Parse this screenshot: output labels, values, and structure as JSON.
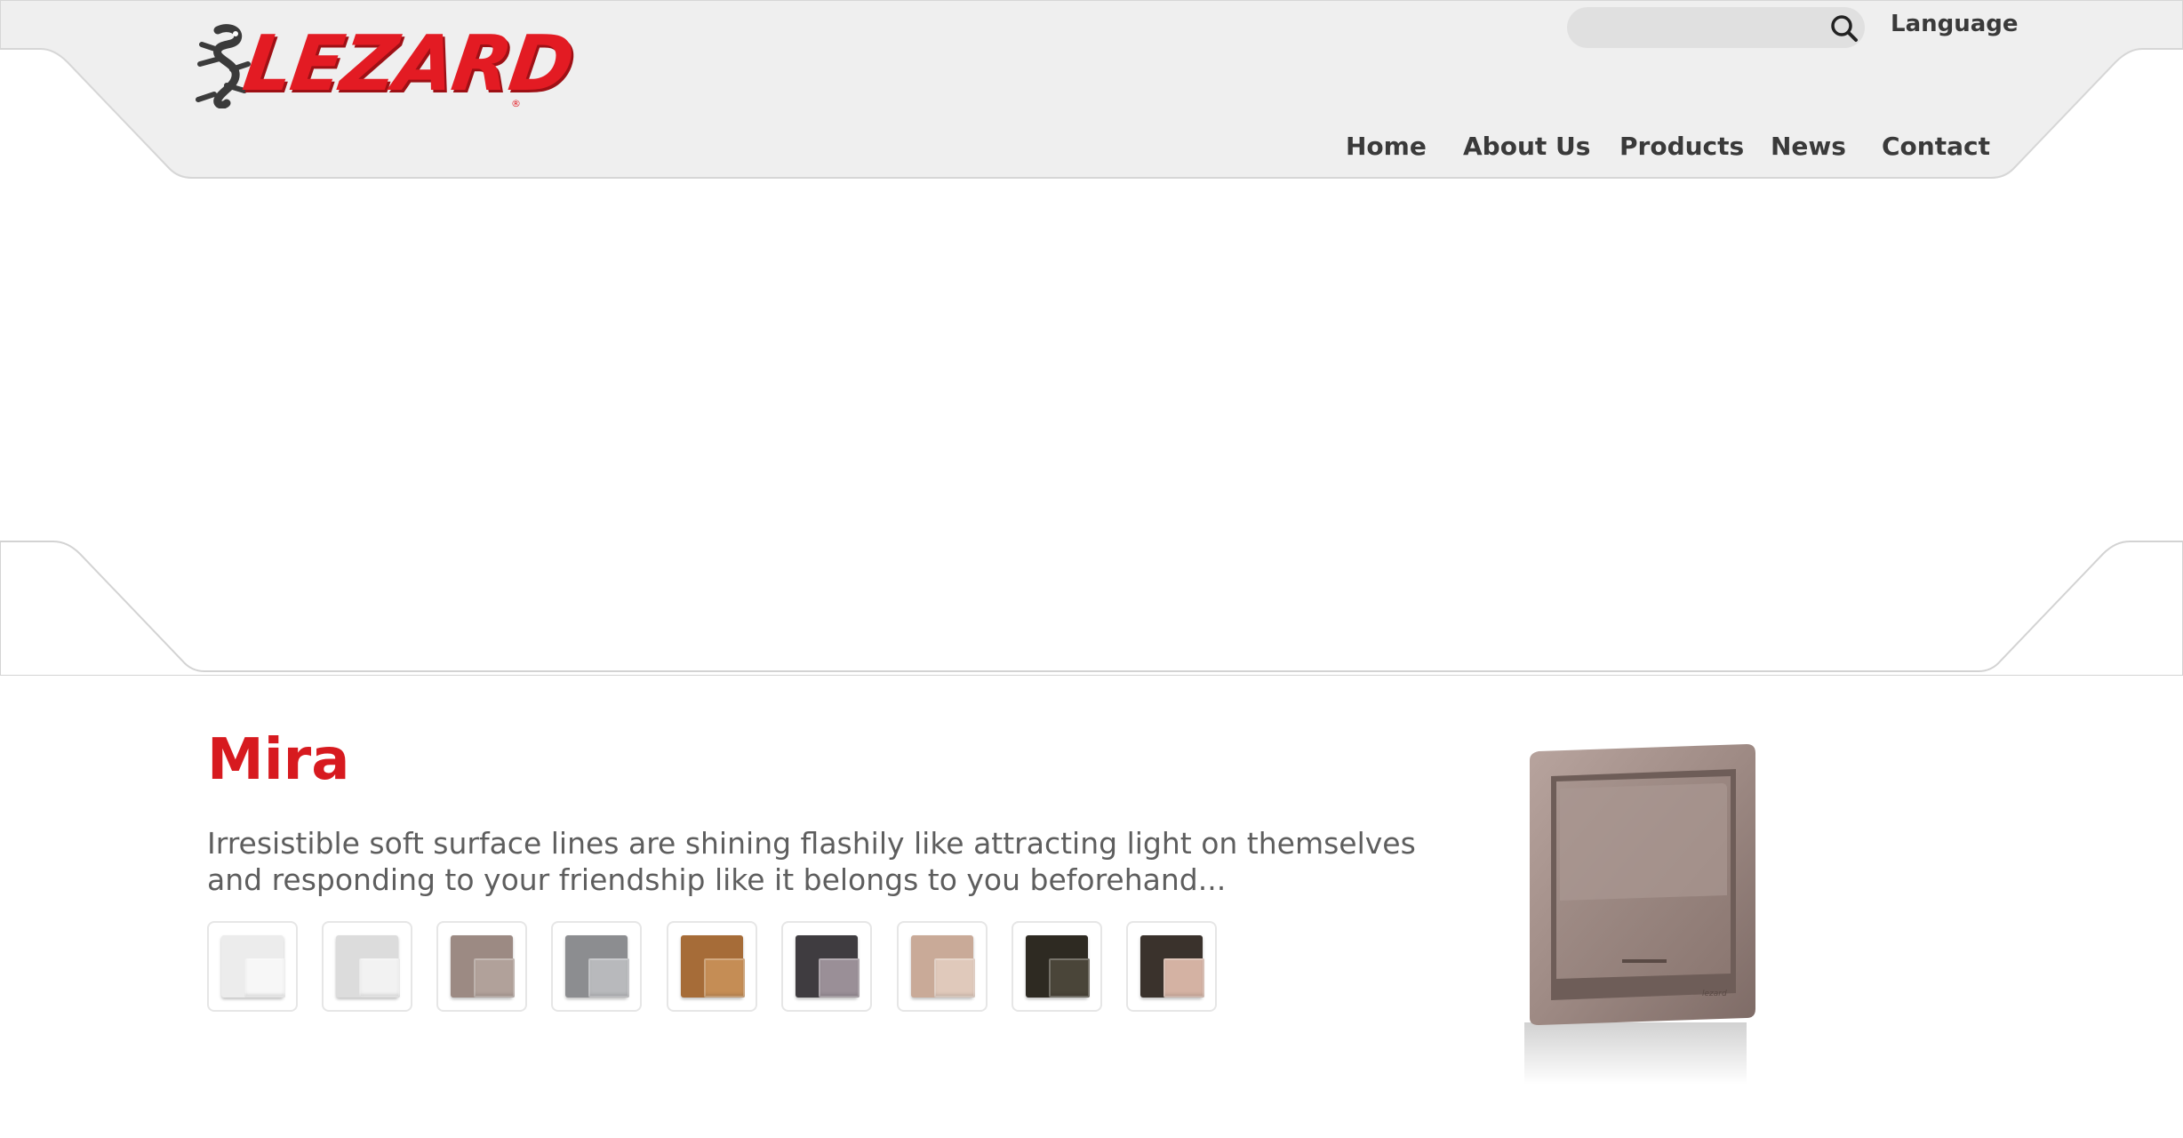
{
  "brand": {
    "name": "LEZARD",
    "mark": "®"
  },
  "search": {
    "placeholder": "",
    "value": ""
  },
  "header": {
    "language_label": "Language"
  },
  "nav": {
    "items": [
      {
        "label": "Home"
      },
      {
        "label": "About Us"
      },
      {
        "label": "Products"
      },
      {
        "label": "News"
      },
      {
        "label": "Contact"
      }
    ]
  },
  "product": {
    "title": "Mira",
    "description": "Irresistible soft surface lines are shining flashily like attracting light on themselves and responding to your friendship like it belongs to you beforehand...",
    "swatches": [
      {
        "plate": "#ececec",
        "rocker": "#f7f7f7"
      },
      {
        "plate": "#dcdcdc",
        "rocker": "#f2f2f2"
      },
      {
        "plate": "#9c8a83",
        "rocker": "#b1a19a"
      },
      {
        "plate": "#8c8d90",
        "rocker": "#b8b9bc"
      },
      {
        "plate": "#a66c38",
        "rocker": "#c58d55"
      },
      {
        "plate": "#3f3c40",
        "rocker": "#9a8f97"
      },
      {
        "plate": "#c9aa98",
        "rocker": "#e0c9bb"
      },
      {
        "plate": "#2e2a22",
        "rocker": "#4a4539"
      },
      {
        "plate": "#3a322c",
        "rocker": "#d4b2a3"
      }
    ]
  },
  "colors": {
    "accent": "#d71a1f",
    "header_bg": "#efefef",
    "nav_text": "#3a3a3a",
    "body_text": "#5e5e5e"
  }
}
